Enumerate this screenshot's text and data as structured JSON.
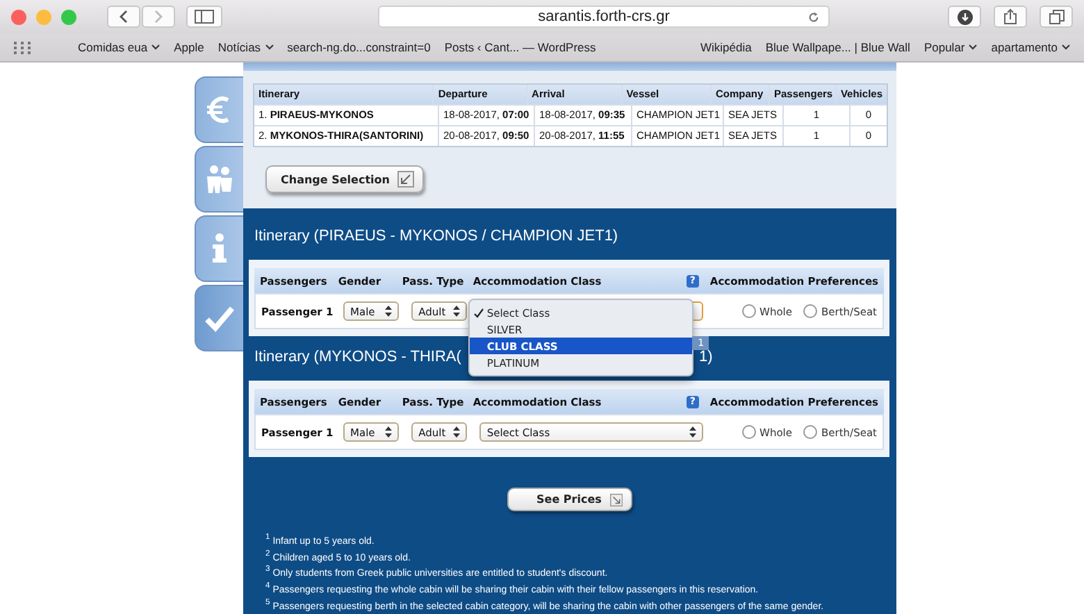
{
  "browser": {
    "url": "sarantis.forth-crs.gr",
    "bookmarks_left": [
      {
        "label": "Comidas eua",
        "has_menu": true
      },
      {
        "label": "Apple",
        "has_menu": false
      },
      {
        "label": "Notícias",
        "has_menu": true
      },
      {
        "label": "search-ng.do...constraint=0",
        "has_menu": false
      },
      {
        "label": "Posts ‹ Cant... — WordPress",
        "has_menu": false
      }
    ],
    "bookmarks_right": [
      {
        "label": "Wikipédia",
        "has_menu": false
      },
      {
        "label": "Blue Wallpape... | Blue Wall",
        "has_menu": false
      },
      {
        "label": "Popular",
        "has_menu": true
      },
      {
        "label": "apartamento",
        "has_menu": true
      }
    ]
  },
  "summary": {
    "columns": [
      "Itinerary",
      "Departure",
      "Arrival",
      "Vessel",
      "Company",
      "Passengers",
      "Vehicles"
    ],
    "rows": [
      [
        "1. **PIRAEUS-MYKONOS**",
        "18-08-2017, **07:00**",
        "18-08-2017, **09:35**",
        "CHAMPION JET1",
        "SEA JETS",
        "1",
        "0"
      ],
      [
        "2. **MYKONOS-THIRA(SANTORINI)**",
        "20-08-2017, **09:50**",
        "20-08-2017, **11:55**",
        "CHAMPION JET1",
        "SEA JETS",
        "1",
        "0"
      ]
    ],
    "button": "Change Selection"
  },
  "itineraries": [
    {
      "title": "Itinerary (PIRAEUS - MYKONOS / CHAMPION JET1)",
      "columns": [
        "Passengers",
        "Gender",
        "Pass. Type",
        "Accommodation Class",
        "Accommodation Preferences"
      ],
      "help": "?",
      "passengers": [
        {
          "name": "Passenger 1",
          "gender": "Male",
          "type": "Adult",
          "options": [
            "Whole",
            "Berth/Seat"
          ],
          "checked": [
            false,
            false
          ],
          "menu": {
            "items": [
              {
                "label": "Select Class",
                "checked": true,
                "selected": false
              },
              {
                "label": "SILVER",
                "checked": false,
                "selected": false
              },
              {
                "label": "CLUB CLASS",
                "checked": false,
                "selected": true
              },
              {
                "label": "PLATINUM",
                "checked": false,
                "selected": false
              }
            ],
            "badge": "1"
          }
        }
      ]
    },
    {
      "title_start": "Itinerary (MYKONOS - THIRA(",
      "title_end": "1)",
      "columns": [
        "Passengers",
        "Gender",
        "Pass. Type",
        "Accommodation Class",
        "Accommodation Preferences"
      ],
      "help": "?",
      "passengers": [
        {
          "name": "Passenger 1",
          "gender": "Male",
          "type": "Adult",
          "class": "Select Class",
          "options": [
            "Whole",
            "Berth/Seat"
          ],
          "checked": [
            false,
            false
          ]
        }
      ]
    }
  ],
  "see_prices": "See Prices",
  "footnotes": [
    "$^{1}$ Infant up to 5 years old.",
    "$^{2}$ Children aged 5 to 10 years old.",
    "$^{3}$ Only students from Greek public universities are entitled to student's discount.",
    "$^{4}$ Passengers requesting the whole cabin will be sharing their cabin with their fellow passengers in this reservation.",
    "$^{5}$ Passengers requesting berth in the selected cabin category, will be sharing the cabin with other passengers of the same gender."
  ]
}
